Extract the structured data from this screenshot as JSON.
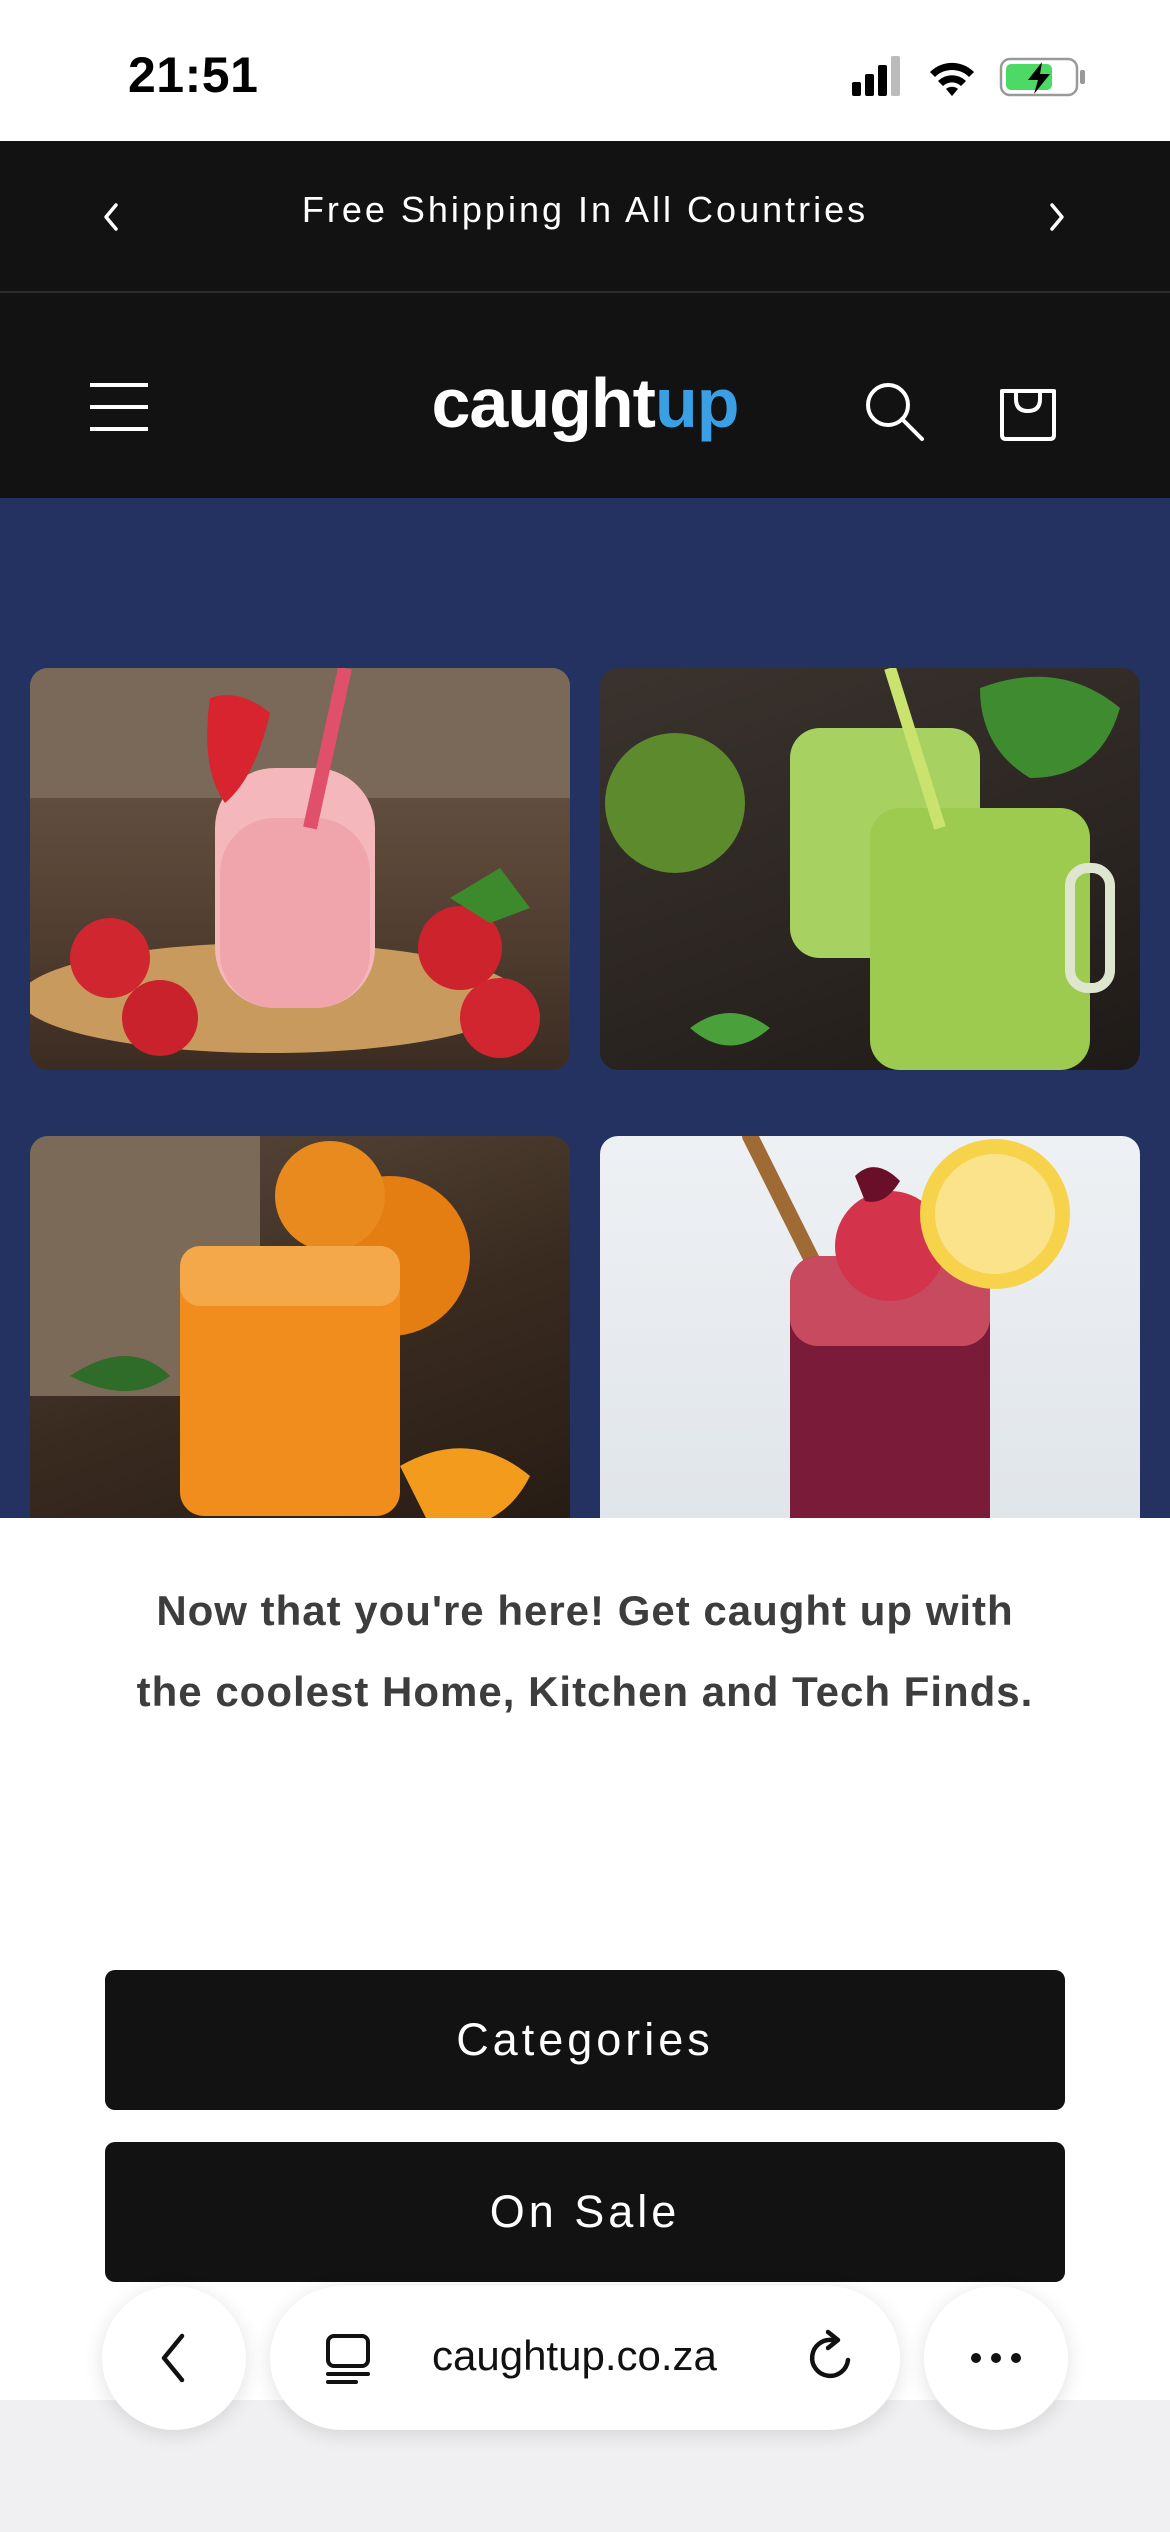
{
  "status_bar": {
    "time": "21:51",
    "icons": [
      "signal-icon",
      "wifi-icon",
      "battery-charging-icon"
    ],
    "battery_color": "#4cd964"
  },
  "announcement": {
    "text": "Free Shipping In All Countries",
    "prev_icon": "chevron-left-icon",
    "next_icon": "chevron-right-icon"
  },
  "header": {
    "logo_part1": "caught",
    "logo_part2": "up",
    "logo_accent_color": "#3aa0e6",
    "menu_icon": "hamburger-icon",
    "search_icon": "search-icon",
    "cart_icon": "cart-icon"
  },
  "hero": {
    "background_color": "#243262",
    "images": [
      "strawberry-smoothie",
      "green-smoothie",
      "orange-juice",
      "berry-lemon-drink"
    ]
  },
  "main": {
    "tagline": "Now that you're here! Get caught up with the coolest Home, Kitchen and Tech Finds.",
    "buttons": [
      {
        "label": "Categories"
      },
      {
        "label": "On Sale"
      }
    ]
  },
  "browser": {
    "url": "caughtup.co.za",
    "back_icon": "chevron-left-icon",
    "tabs_icon": "page-icon",
    "reload_icon": "reload-icon",
    "more_icon": "more-icon"
  }
}
